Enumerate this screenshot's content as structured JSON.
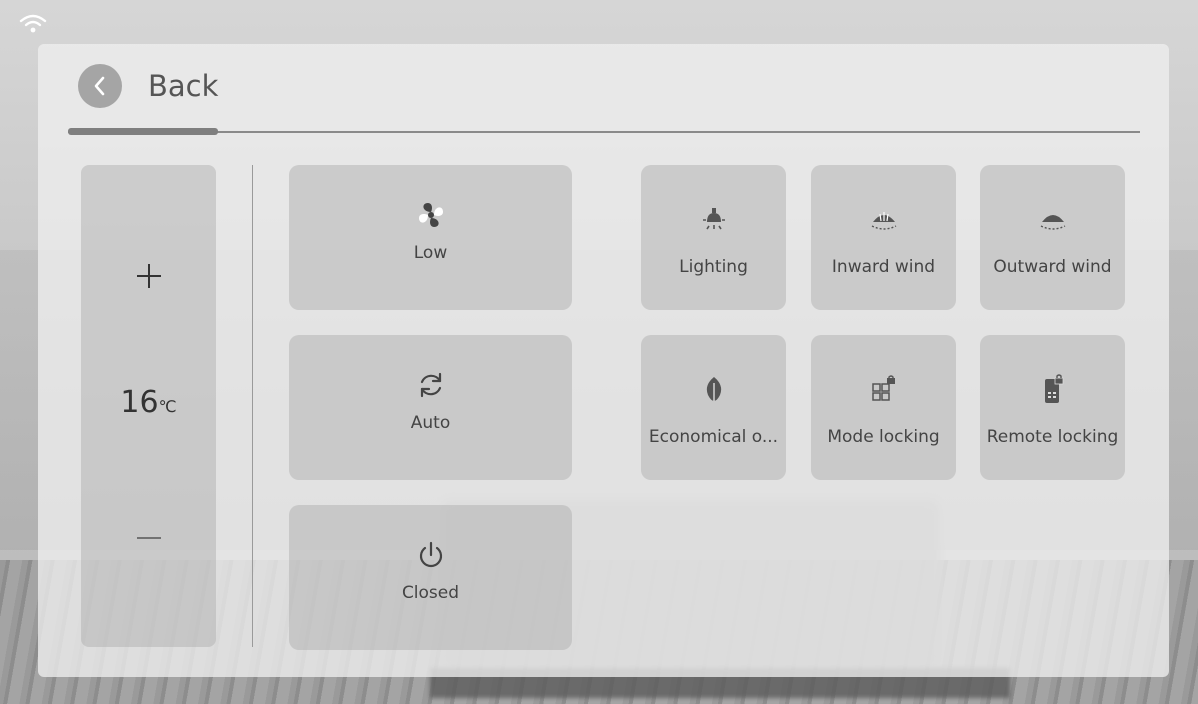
{
  "header": {
    "back_label": "Back"
  },
  "temperature": {
    "value": "16",
    "unit": "℃"
  },
  "modes": {
    "fan": {
      "label": "Low",
      "icon": "fan-icon"
    },
    "mode": {
      "label": "Auto",
      "icon": "refresh-icon"
    },
    "power": {
      "label": "Closed",
      "icon": "power-icon"
    }
  },
  "functions": [
    {
      "label": "Lighting",
      "icon": "lamp-icon"
    },
    {
      "label": "Inward wind",
      "icon": "inward-wind-icon"
    },
    {
      "label": "Outward wind",
      "icon": "outward-wind-icon"
    },
    {
      "label": "Economical o...",
      "icon": "leaf-icon"
    },
    {
      "label": "Mode locking",
      "icon": "mode-lock-icon"
    },
    {
      "label": "Remote locking",
      "icon": "remote-lock-icon"
    }
  ]
}
